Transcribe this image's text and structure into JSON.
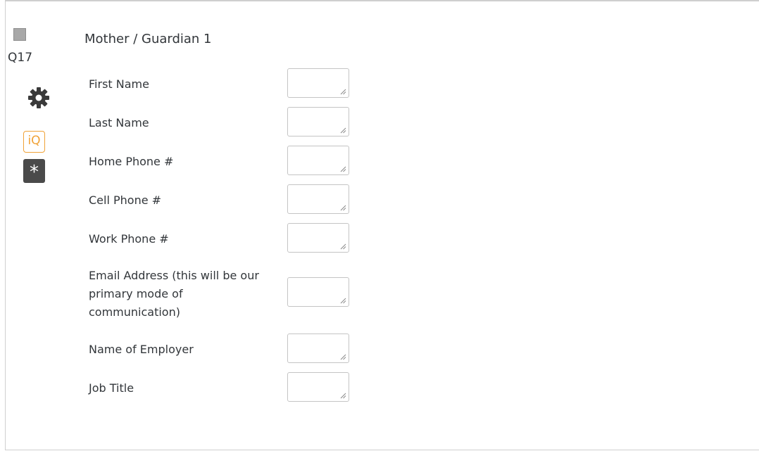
{
  "question": {
    "number": "Q17",
    "title": "Mother / Guardian 1",
    "icons": {
      "select": "square-checkbox-icon",
      "settings": "gear-icon",
      "iq": "iQ",
      "required": "*"
    },
    "fields": [
      {
        "label": "First Name",
        "value": ""
      },
      {
        "label": "Last Name",
        "value": ""
      },
      {
        "label": "Home Phone #",
        "value": ""
      },
      {
        "label": "Cell Phone #",
        "value": ""
      },
      {
        "label": "Work Phone #",
        "value": ""
      },
      {
        "label": "Email Address (this will be our primary mode of communication)",
        "value": ""
      },
      {
        "label": "Name of Employer",
        "value": ""
      },
      {
        "label": "Job Title",
        "value": ""
      }
    ]
  },
  "colors": {
    "accent": "#f0a237",
    "required_bg": "#4a4a4a",
    "border": "#c4c4c4"
  }
}
